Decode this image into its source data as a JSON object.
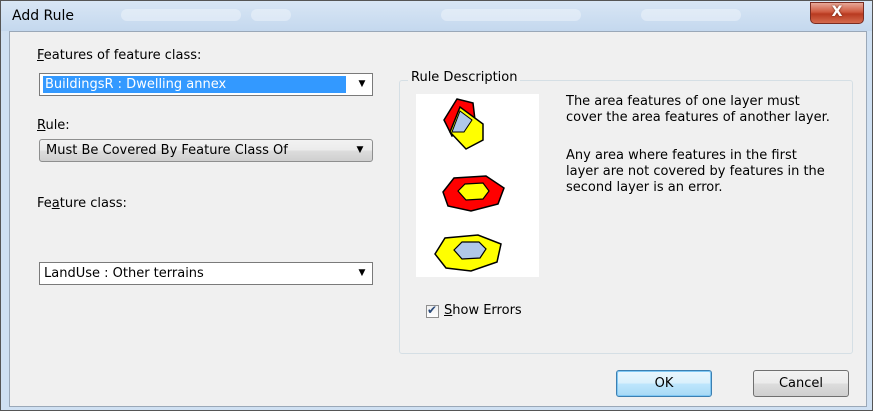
{
  "window": {
    "title": "Add Rule",
    "close_glyph": "X"
  },
  "features_of": {
    "label_first": "F",
    "label_rest": "eatures of feature class:",
    "value": "BuildingsR : Dwelling annex"
  },
  "rule": {
    "label_first": "R",
    "label_rest": "ule:",
    "value": "Must Be Covered By Feature Class Of"
  },
  "feature_class": {
    "label_first": "Fe",
    "label_underlined": "a",
    "label_rest": "ture class:",
    "value": "LandUse : Other terrains"
  },
  "rule_description": {
    "title": "Rule Description",
    "paragraph1": "The area features of one layer must cover the area features of another layer.",
    "paragraph2": "Any area where features in the first layer are not covered by features in the second layer is an error."
  },
  "show_errors": {
    "checked": true,
    "label_first": "S",
    "label_rest": "how Errors"
  },
  "buttons": {
    "ok": "OK",
    "cancel": "Cancel"
  },
  "colors": {
    "error_red": "#ff0000",
    "feature_yellow": "#ffff00",
    "covered_blue": "#b0c8e8",
    "selection_blue": "#3399ff"
  }
}
